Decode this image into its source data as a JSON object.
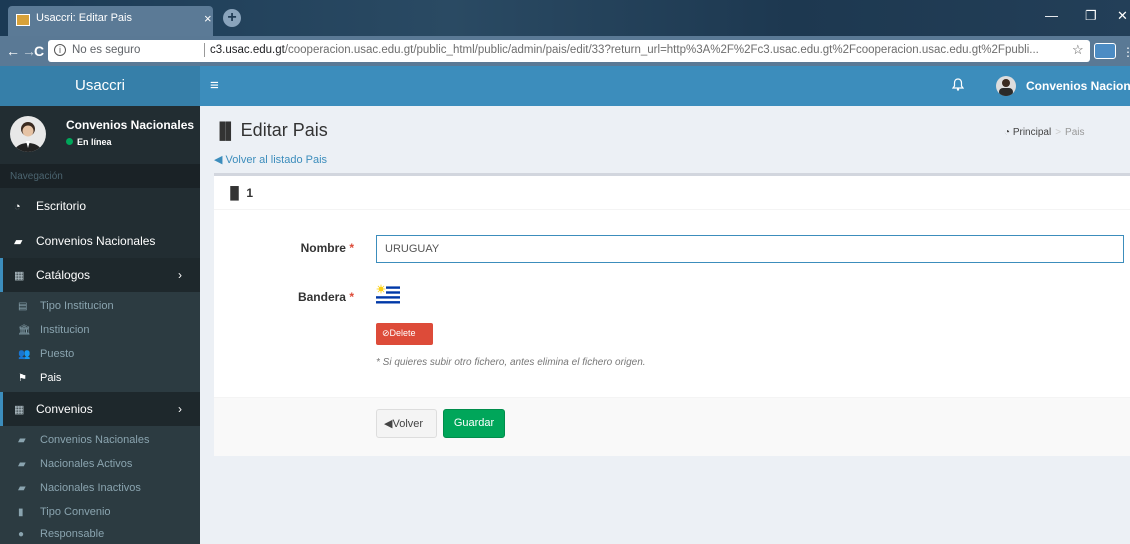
{
  "browser": {
    "tab_title": "Usaccri: Editar Pais",
    "tab_close": "×",
    "new_tab": "+",
    "back": "←",
    "forward": "→",
    "reload": "C",
    "security_label": "No es seguro",
    "url_domain": "c3.usac.edu.gt",
    "url_path": "/cooperacion.usac.edu.gt/public_html/public/admin/pais/edit/33?return_url=http%3A%2F%2Fc3.usac.edu.gt%2Fcooperacion.usac.edu.gt%2Fpubli...",
    "star": "☆",
    "minimize": "—",
    "restore": "❐",
    "close": "✕"
  },
  "header": {
    "logo": "Usaccri",
    "menu_icon": "≡",
    "bell_icon": "♫",
    "user_name": "Convenios Nacionales"
  },
  "sidebar": {
    "user_name": "Convenios Nacionales",
    "user_status": "En línea",
    "section_header": "Navegación",
    "items": [
      {
        "label": "Escritorio",
        "icon": "dashboard-icon"
      },
      {
        "label": "Convenios Nacionales",
        "icon": "file-icon"
      },
      {
        "label": "Catálogos",
        "icon": "table-icon"
      },
      {
        "label": "Convenios",
        "icon": "table-icon"
      }
    ],
    "catalogos_sub": [
      {
        "label": "Tipo Institucion",
        "icon": "building-icon"
      },
      {
        "label": "Institucion",
        "icon": "institution-icon"
      },
      {
        "label": "Puesto",
        "icon": "users-icon"
      },
      {
        "label": "Pais",
        "icon": "flag-icon"
      }
    ],
    "convenios_sub": [
      {
        "label": "Convenios Nacionales",
        "icon": "file-icon"
      },
      {
        "label": "Nacionales Activos",
        "icon": "file-icon"
      },
      {
        "label": "Nacionales Inactivos",
        "icon": "file-icon"
      },
      {
        "label": "Tipo Convenio",
        "icon": "bookmark-icon"
      },
      {
        "label": "Responsable",
        "icon": "user-icon"
      }
    ]
  },
  "content": {
    "title": "Editar Pais",
    "breadcrumb_home": "Principal",
    "breadcrumb_sep": ">",
    "breadcrumb_current": "Pais",
    "back_link": "Volver al listado Pais",
    "box_title": "1",
    "form": {
      "nombre_label": "Nombre",
      "nombre_value": "URUGUAY",
      "bandera_label": "Bandera",
      "required_mark": "*",
      "delete_label": "Delete",
      "hint": "* Si quieres subir otro fichero, antes elimina el fichero origen."
    },
    "buttons": {
      "back": "Volver",
      "save": "Guardar"
    }
  }
}
